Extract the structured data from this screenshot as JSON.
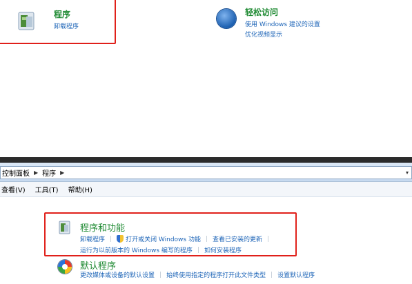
{
  "top": {
    "programs": {
      "title": "程序",
      "link": "卸载程序"
    },
    "ease_of_access": {
      "title": "轻松访问",
      "links": [
        "使用 Windows 建议的设置",
        "优化视频显示"
      ]
    }
  },
  "address_bar": {
    "crumbs": [
      "控制面板",
      "程序"
    ],
    "dropdown": "▾"
  },
  "menu": {
    "items": [
      "查看(V)",
      "工具(T)",
      "帮助(H)"
    ]
  },
  "sections": {
    "programs_features": {
      "title": "程序和功能",
      "row1": [
        "卸载程序",
        "打开或关闭 Windows 功能",
        "查看已安装的更新"
      ],
      "row2": [
        "运行为以前版本的 Windows 编写的程序",
        "如何安装程序"
      ]
    },
    "default_programs": {
      "title": "默认程序",
      "row1": [
        "更改媒体或设备的默认设置",
        "始终使用指定的程序打开此文件类型",
        "设置默认程序"
      ]
    }
  },
  "colors": {
    "highlight": "#e0201a",
    "title_green": "#1e8a32",
    "link_blue": "#1f66b8"
  },
  "icons": [
    "programs-icon",
    "ease-of-access-icon",
    "shield-icon",
    "default-programs-icon"
  ]
}
